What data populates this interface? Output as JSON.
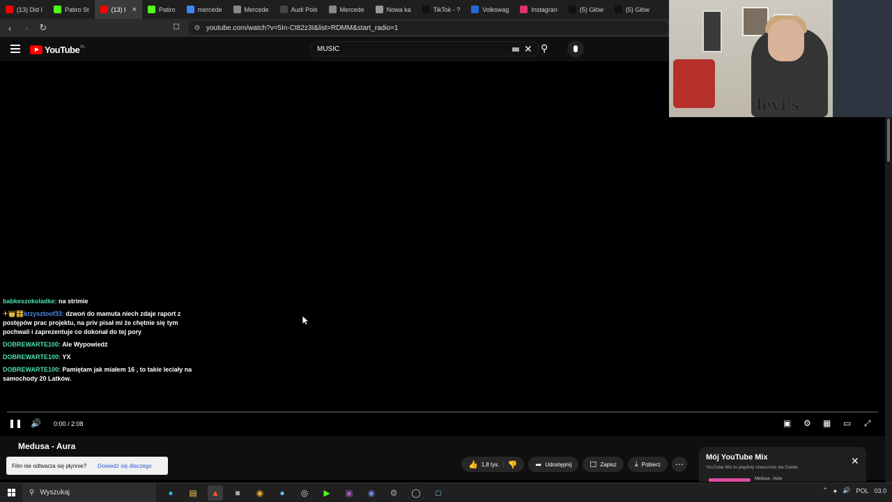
{
  "browser": {
    "tabs": [
      {
        "label": "(13) Did I",
        "favicon": "youtube-icon",
        "color": "#ff0000",
        "active": false
      },
      {
        "label": "Patiro St",
        "favicon": "kick-icon",
        "color": "#53fc18",
        "active": false
      },
      {
        "label": "(13) I",
        "favicon": "youtube-icon",
        "color": "#ff0000",
        "active": true
      },
      {
        "label": "Patiro",
        "favicon": "kick-icon",
        "color": "#53fc18",
        "active": false
      },
      {
        "label": "mercede",
        "favicon": "google-icon",
        "color": "#4285f4",
        "active": false
      },
      {
        "label": "Mercede",
        "favicon": "mercedes-icon",
        "color": "#888888",
        "active": false
      },
      {
        "label": "Audi Pols",
        "favicon": "audi-icon",
        "color": "#444444",
        "active": false
      },
      {
        "label": "Mercede",
        "favicon": "mercedes-icon",
        "color": "#888888",
        "active": false
      },
      {
        "label": "Nowa ka",
        "favicon": "shield-icon",
        "color": "#999999",
        "active": false
      },
      {
        "label": "TikTok - ?",
        "favicon": "tiktok-icon",
        "color": "#111111",
        "active": false
      },
      {
        "label": "Volkswag",
        "favicon": "vw-icon",
        "color": "#1e6bd6",
        "active": false
      },
      {
        "label": "Instagran",
        "favicon": "instagram-icon",
        "color": "#e1306c",
        "active": false
      },
      {
        "label": "(5) Głów",
        "favicon": "x-icon",
        "color": "#111111",
        "active": false
      },
      {
        "label": "(5) Głów",
        "favicon": "x-icon",
        "color": "#111111",
        "active": false
      }
    ],
    "url": "youtube.com/watch?v=5In-Ct82z3I&list=RDMM&start_radio=1"
  },
  "youtube": {
    "logo_text": "YouTube",
    "country": "PL",
    "search_value": "MUSIC"
  },
  "chat": [
    {
      "user": "babkeszokoladke",
      "text": "na strimie",
      "badges": "",
      "user_color": "green"
    },
    {
      "user": "krzysztoof33",
      "text": "dzwoń do mamuta niech zdaje raport z postępów prac projektu, na priv pisał mi że chętnie się tym pochwali i zaprezentuje co dokonał do tej pory",
      "badges": "✈👑🎛",
      "user_color": "blue"
    },
    {
      "user": "DOBREWARTE100",
      "text": "Ale Wypowiedź",
      "badges": "",
      "user_color": "green"
    },
    {
      "user": "DOBREWARTE100",
      "text": "YX",
      "badges": "",
      "user_color": "green"
    },
    {
      "user": "DOBREWARTE100",
      "text": "Pamiętam jak miałem 16 , to takie leciały na samochody 20 Latków.",
      "badges": "",
      "user_color": "green"
    }
  ],
  "player": {
    "time": "0:00 / 2:08",
    "progress": 0
  },
  "video": {
    "title": "Medusa - Aura",
    "likes": "1,8 tys.",
    "share_label": "Udostępnij",
    "save_label": "Zapisz",
    "download_label": "Pobierz"
  },
  "toast": {
    "text": "Film nie odtwarza się płynnie?",
    "link": "Dowiedz się dlaczego"
  },
  "mix": {
    "title": "Mój YouTube Mix",
    "subtitle": "YouTube Mix to playlisty stworzone dla Ciebie",
    "item": "Medusa - Aura"
  },
  "taskbar": {
    "search_placeholder": "Wyszukaj",
    "lang": "POL",
    "date": "03.0"
  },
  "colors": {
    "youtube_red": "#ff0000",
    "chat_user_green": "#4fe0b0",
    "chat_user_blue": "#4a8ef0"
  }
}
